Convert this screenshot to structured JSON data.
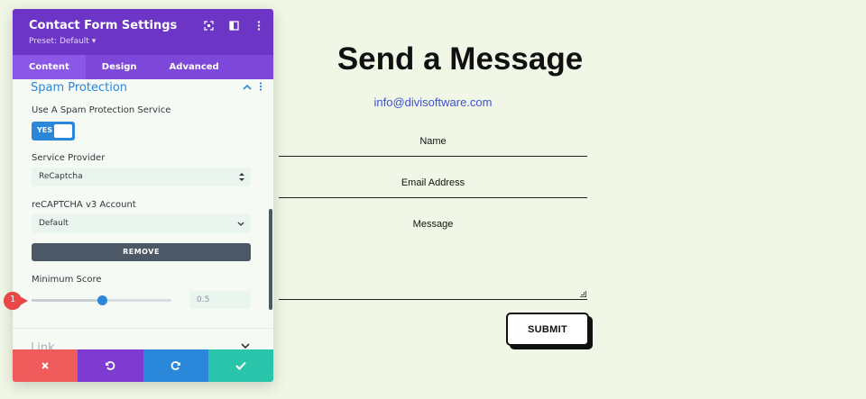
{
  "page": {
    "title": "Send a Message",
    "email": "info@divisoftware.com",
    "fields": {
      "name_label": "Name",
      "email_label": "Email Address",
      "message_label": "Message"
    },
    "submit_label": "SUBMIT"
  },
  "panel": {
    "title": "Contact Form Settings",
    "preset": "Preset: Default ▾",
    "tabs": [
      "Content",
      "Design",
      "Advanced"
    ],
    "active_tab": "Content",
    "section_title": "Spam Protection",
    "spam_label": "Use A Spam Protection Service",
    "toggle_text": "YES",
    "provider_label": "Service Provider",
    "provider_value": "ReCaptcha",
    "account_label": "reCAPTCHA v3 Account",
    "account_value": "Default",
    "remove_label": "REMOVE",
    "min_score_label": "Minimum Score",
    "min_score_value": "0.5",
    "min_score_fraction": 0.5,
    "next_section": "Link"
  },
  "marker": {
    "number": "1"
  },
  "colors": {
    "panel_purple": "#6c35c6",
    "accent_blue": "#2b87da",
    "cancel_red": "#ef5a5a",
    "save_green": "#29c4a9",
    "page_bg": "#f1f7e6",
    "marker_red": "#e94848"
  },
  "icons": {
    "header": [
      "fullscreen-icon",
      "sidebar-toggle-icon",
      "more-options-icon"
    ],
    "footer": [
      "close-icon",
      "undo-icon",
      "redo-icon",
      "check-icon"
    ]
  }
}
